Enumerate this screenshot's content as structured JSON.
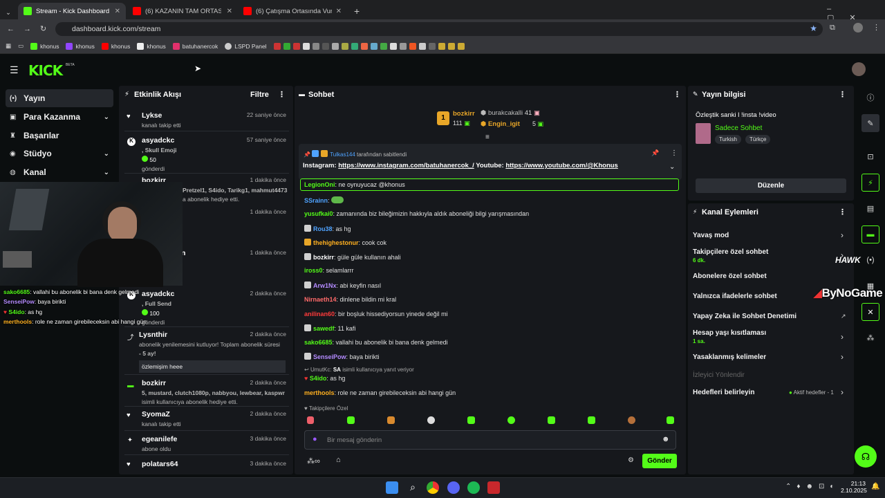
{
  "browser": {
    "tabs": [
      {
        "title": "Stream - Kick Dashboard",
        "color": "#53fc18"
      },
      {
        "title": "(6) KAZANIN TAM ORTASINDA",
        "color": "#ff0000"
      },
      {
        "title": "(6) Çatışma Ortasında Vurulan",
        "color": "#ff0000"
      }
    ],
    "url": "dashboard.kick.com/stream",
    "bookmarks": [
      {
        "label": "khonus",
        "color": "#53fc18"
      },
      {
        "label": "khonus",
        "color": "#9146ff"
      },
      {
        "label": "khonus",
        "color": "#ff0000"
      },
      {
        "label": "khonus",
        "color": "#ffffff"
      },
      {
        "label": "batuhanercok",
        "color": "#e1306c"
      },
      {
        "label": "LSPD Panel",
        "color": "#cccccc"
      }
    ]
  },
  "kick": {
    "logo": "KICK",
    "beta": "BETA"
  },
  "sidebar": {
    "items": [
      {
        "label": "Yayın",
        "icon": "broadcast-icon"
      },
      {
        "label": "Para Kazanma",
        "icon": "money-icon"
      },
      {
        "label": "Başarılar",
        "icon": "trophy-icon"
      },
      {
        "label": "Stüdyo",
        "icon": "studio-icon"
      },
      {
        "label": "Kanal",
        "icon": "channel-icon"
      }
    ]
  },
  "overlay_chat": [
    {
      "user": "sako6685",
      "text": ": vallahi bu abonelik bi bana denk gelmedi",
      "color": "#d8d8d8"
    },
    {
      "user": "SenseiPow",
      "text": ": baya birikti",
      "color": "#b48bff"
    },
    {
      "user": "S4ido",
      "text": ": as hg",
      "color": "#53fc18"
    },
    {
      "user": "merthools",
      "text": ": role ne zaman girebileceksin abi hangi gün",
      "color": "#ffb020"
    }
  ],
  "activity": {
    "title": "Etkinlik Akışı",
    "filter": "Filtre",
    "events": [
      {
        "name": "Lykse",
        "time": "22 saniye önce",
        "desc": "kanalı takip etti"
      },
      {
        "name": "asyadckc",
        "time": "57 saniye önce",
        "desc": ", Skull Emoji",
        "amount": "50",
        "sub": "gönderdi"
      },
      {
        "name": "bozkirr",
        "time": "1 dakika önce",
        "desc": "Pretzel1, S4ido, Tarikg1, mahmut4473",
        "sub": "a abonelik hediye etti."
      },
      {
        "name": "",
        "time": "1 dakika önce"
      },
      {
        "name": "n",
        "time": "1 dakika önce"
      },
      {
        "name": "asyadckc",
        "time": "2 dakika önce",
        "desc": ", Full Send",
        "amount": "100",
        "sub": "gönderdi"
      },
      {
        "name": "Lysnthir",
        "time": "2 dakika önce",
        "desc": "abonelik yenilemesini kutluyor! Toplam abonelik süresi",
        "desc2": "- 5 ay!",
        "quote": "özlemişim heee"
      },
      {
        "name": "bozkirr",
        "time": "2 dakika önce",
        "desc": "5, mustard, clutch1080p, nabbyou, lewbear, kaspwr",
        "sub": "isimli kullanıcıya abonelik hediye etti."
      },
      {
        "name": "SyomaZ",
        "time": "2 dakika önce",
        "desc": "kanalı takip etti"
      },
      {
        "name": "egeanilefe",
        "time": "3 dakika önce",
        "desc": "abone oldu"
      },
      {
        "name": "polatars64",
        "time": "3 dakika önce"
      }
    ]
  },
  "chat": {
    "title": "Sohbet",
    "top": {
      "rank": "1",
      "name1": "bozkirr",
      "n1": "111",
      "name2": "burakcakalli",
      "n2": "41",
      "name3": "Engin_igit",
      "n3": "5"
    },
    "pinned": {
      "by": "Tulkas144",
      "by_suffix": "tarafından sabitlendi",
      "prefix": "Instagram:",
      "link1": "https://www.instagram.com/batuhanercok_/",
      "mid": "Youtube:",
      "link2": "https://www.youtube.com/@Khonus"
    },
    "highlight": {
      "user": "LegionOni",
      "text": ": ne oynuyucaz @khonus"
    },
    "messages": [
      {
        "user": "SSrainn",
        "text": ":",
        "color": "#4fa3ff"
      },
      {
        "user": "yusufkai0",
        "text": ": zamanında biz bileğimizin hakkıyla aldık aboneliği bilgi yarışmasından",
        "color": "#53fc18"
      },
      {
        "user": "Rou38",
        "text": ": as hg",
        "color": "#4fa3ff"
      },
      {
        "user": "thehighestonur",
        "text": ": cook cok",
        "color": "#ffb020"
      },
      {
        "user": "bozkirr",
        "text": ": güle güle kullanın ahali",
        "color": "#ffffff"
      },
      {
        "user": "iross0",
        "text": ": selamlarrr",
        "color": "#53fc18"
      },
      {
        "user": "Arw1Nx",
        "text": ": abi keyfin nasıl",
        "color": "#b48bff"
      },
      {
        "user": "Nirnaeth14",
        "text": ": dinlene bildin mi kral",
        "color": "#ff6a6a"
      },
      {
        "user": "anilinan60",
        "text": ": bir boşluk hissediyorsun yinede değil mi",
        "color": "#ff3b3b"
      },
      {
        "user": "sawedf",
        "text": ": 11 kafi",
        "color": "#53fc18"
      },
      {
        "user": "sako6685",
        "text": ": vallahi bu abonelik bi bana denk gelmedi",
        "color": "#53fc18"
      },
      {
        "user": "SenseiPow",
        "text": ": baya birikti",
        "color": "#b48bff"
      }
    ],
    "reply": {
      "to": "UmutKc:",
      "to_tag": "SA",
      "tail": "isimli kullanıcıya yanıt veriyor",
      "user": "S4ido",
      "text": ": as hg"
    },
    "last": {
      "user": "merthools",
      "text": ": role ne zaman girebileceksin abi hangi gün"
    },
    "followers_only": "Takipçilere Özel",
    "placeholder": "Bir mesaj gönderin",
    "send": "Gönder"
  },
  "streaminfo": {
    "title": "Yayın bilgisi",
    "stream_title": "Özleştik sanki l !insta !video",
    "category": "Sadece Sohbet",
    "tags": [
      "Turkish",
      "Türkçe"
    ],
    "edit": "Düzenle"
  },
  "actions": {
    "title": "Kanal Eylemleri",
    "items": [
      {
        "label": "Yavaş mod"
      },
      {
        "label": "Takipçilere özel sohbet",
        "sub": "6 dk."
      },
      {
        "label": "Abonelere özel sohbet"
      },
      {
        "label": "Yalnızca ifadelerle sohbet"
      },
      {
        "label": "Yapay Zeka ile Sohbet Denetimi"
      },
      {
        "label": "Hesap yaşı kısıtlaması",
        "sub": "1 sa."
      },
      {
        "label": "Yasaklanmış kelimeler"
      },
      {
        "label": "İzleyici Yönlendir"
      },
      {
        "label": "Hedefleri belirleyin",
        "status": "Aktif hedefler - 1"
      }
    ]
  },
  "watermark": {
    "line1": "HAWK",
    "line2": "ByNoGame"
  },
  "taskbar": {
    "time": "21:13",
    "date": "2.10.2025"
  },
  "colors": {
    "accent": "#53fc18",
    "panel": "#16181c",
    "bg": "#0b0e0f"
  }
}
